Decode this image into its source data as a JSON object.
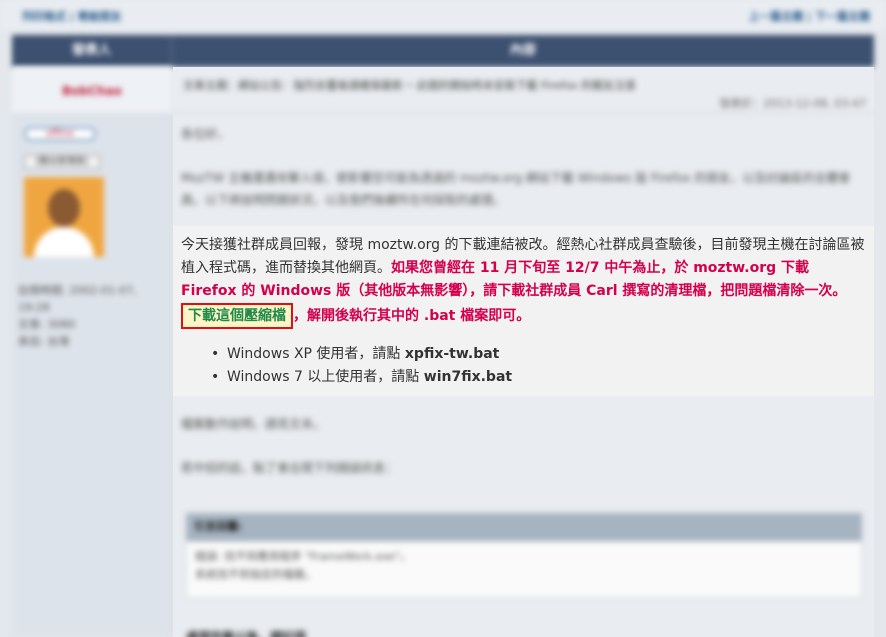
{
  "topbar": {
    "left": "列印格式 | 寄給朋友",
    "right": "上一篇主題 | 下一篇主題"
  },
  "table_header": {
    "author": "發表人",
    "content": "內容"
  },
  "author": {
    "name": "BobChao",
    "status": "offline",
    "rank": "[酷站管理員]",
    "stats": [
      "註冊時間: 2002-01-07, 19:28",
      "文章: 3080",
      "來自: 台灣"
    ]
  },
  "post": {
    "breadcrumb": "文章主題：網站公告：強烈去覆後請確保最新 ─ 此錯的開始時未安裝下載 Firefox 的親友注意",
    "date": "發表於：2013-12-08, 03:47",
    "greeting": "各位好，",
    "intro": "MozTW 主機遭遇攻擊入侵，使影響您可能為透過的 moztw.org 網站下載 Windows 版 Firefox 的朋友，以及討論區的全體會員。以下將說明問題狀況，以及我們後續所在何採取的處理。",
    "main_normal": "今天接獲社群成員回報，發現 moztw.org 的下載連結被改。經熱心社群成員查驗後，目前發現主機在討論區被植入程式碼，進而替換其他網頁。",
    "main_red_1": "如果您曾經在 11 月下旬至 12/7 中午為止，於 moztw.org 下載 Firefox 的 Windows 版（其他版本無影響），請下載社群成員 Carl 撰寫的清理檔，把問題檔清除一次。",
    "download_link": "下載這個壓縮檔",
    "main_red_2": "，解開後執行其中的 .bat 檔案即可。",
    "bullets": [
      {
        "text": "Windows XP 使用者，請點 ",
        "file": "xpfix-tw.bat"
      },
      {
        "text": "Windows 7 以上使用者，請點 ",
        "file": "win7fix.bat"
      }
    ],
    "after_1": "檔案動作說明，請見文末。",
    "after_2": "若中招的話，點了會出現下列錯誤訊息：",
    "code_header": "引言回覆:",
    "code_lines": [
      "錯誤: 找不到應用程序 \"FrameWork.exe\"。",
      "系統找不到指定的檔案。"
    ],
    "bottom": "處理完畢以後，請記得"
  }
}
